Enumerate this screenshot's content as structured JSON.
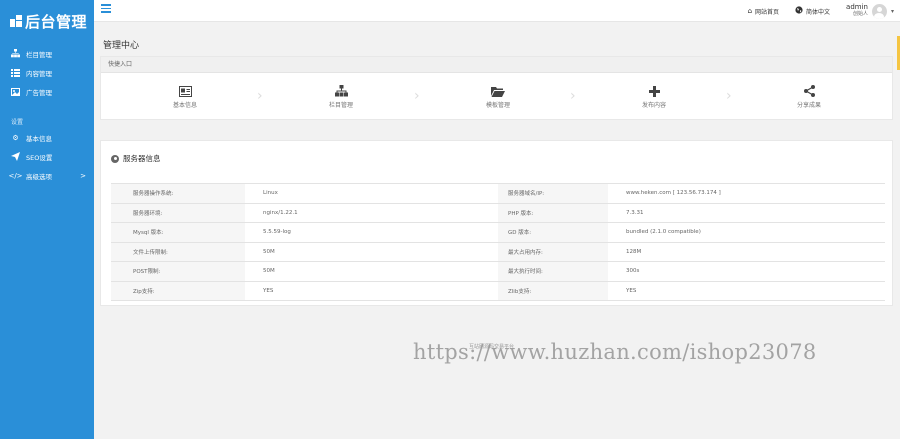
{
  "logo": {
    "text": "后台管理"
  },
  "sidebar": {
    "items": [
      {
        "label": "栏目管理",
        "icon": "sitemap-icon"
      },
      {
        "label": "内容管理",
        "icon": "list-icon"
      },
      {
        "label": "广告管理",
        "icon": "image-icon"
      }
    ],
    "section_label": "设置",
    "settings": [
      {
        "label": "基本信息",
        "icon": "gear-icon"
      },
      {
        "label": "SEO设置",
        "icon": "send-icon"
      },
      {
        "label": "高级选项",
        "icon": "code-icon",
        "arrow": ">"
      }
    ]
  },
  "topbar": {
    "site_home": "网站首页",
    "language": "简体中文",
    "username": "admin",
    "role": "创始人",
    "caret": "▾"
  },
  "page": {
    "title": "管理中心"
  },
  "quick": {
    "header": "快捷入口",
    "items": [
      {
        "label": "基本信息",
        "icon": "id-card-icon"
      },
      {
        "label": "栏目管理",
        "icon": "sitemap-icon"
      },
      {
        "label": "模板管理",
        "icon": "folder-open-icon"
      },
      {
        "label": "发布内容",
        "icon": "plus-icon"
      },
      {
        "label": "分享成果",
        "icon": "share-icon"
      }
    ]
  },
  "server": {
    "title": "服务器信息",
    "rows": [
      [
        "服务器操作系统:",
        "Linux",
        "服务器域名/IP:",
        "www.heken.com [ 123.56.73.174 ]"
      ],
      [
        "服务器环境:",
        "nginx/1.22.1",
        "PHP 版本:",
        "7.3.31"
      ],
      [
        "Mysql 版本:",
        "5.5.59-log",
        "GD 版本:",
        "bundled (2.1.0 compatible)"
      ],
      [
        "文件上传限制:",
        "50M",
        "最大占用内存:",
        "128M"
      ],
      [
        "POST限制:",
        "50M",
        "最大执行时间:",
        "300s"
      ],
      [
        "Zip支持:",
        "YES",
        "Zlib支持:",
        "YES"
      ]
    ]
  },
  "watermark": {
    "text": "https://www.huzhan.com/ishop23078",
    "small": "互站网源码交易平台"
  }
}
